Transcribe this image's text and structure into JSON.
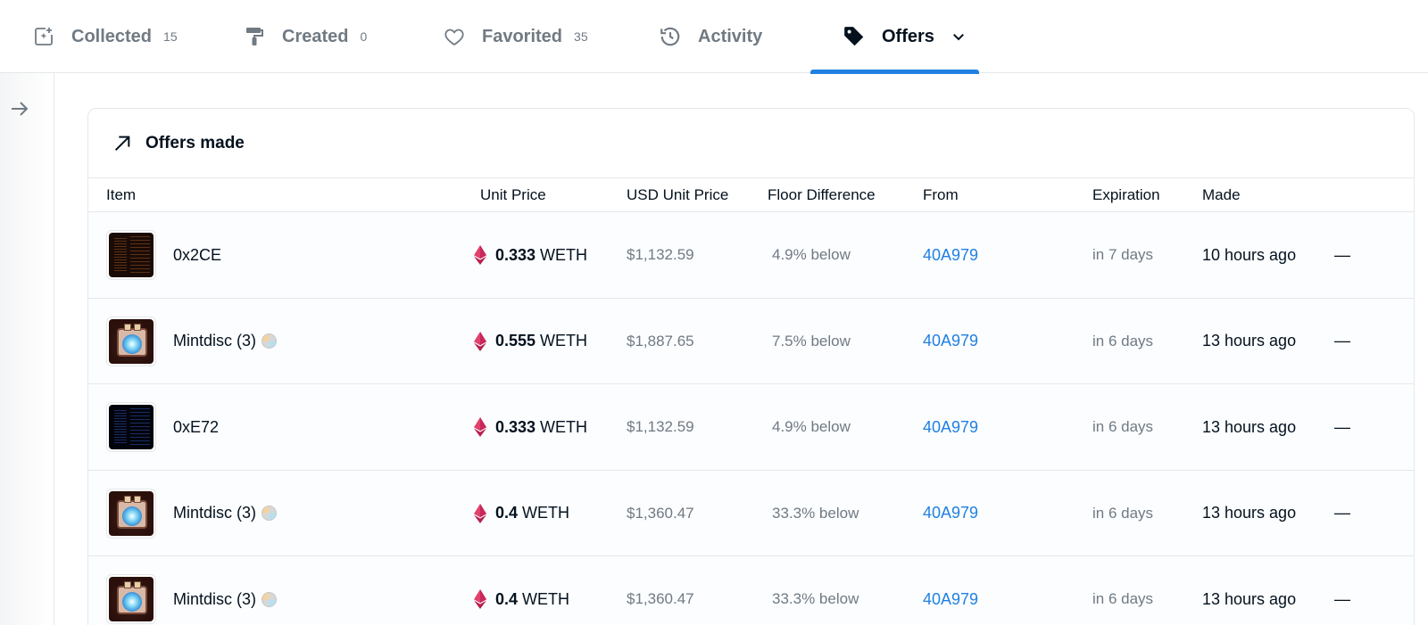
{
  "tabs": [
    {
      "label": "Collected",
      "count": "15",
      "icon": "collected-icon"
    },
    {
      "label": "Created",
      "count": "0",
      "icon": "paint-roller-icon"
    },
    {
      "label": "Favorited",
      "count": "35",
      "icon": "heart-icon"
    },
    {
      "label": "Activity",
      "count": "",
      "icon": "history-icon"
    },
    {
      "label": "Offers",
      "count": "",
      "icon": "tag-icon",
      "active": true
    }
  ],
  "colors": {
    "accent": "#2081e2",
    "text": "#04111d",
    "muted": "#707a83",
    "eth": "#e0426b"
  },
  "card": {
    "title": "Offers made",
    "icon": "arrow-up-right-icon"
  },
  "columns": [
    "Item",
    "Unit Price",
    "USD Unit Price",
    "Floor Difference",
    "From",
    "Expiration",
    "Made"
  ],
  "rows": [
    {
      "item": "0x2CE",
      "thumb": "dark-orange",
      "badge": false,
      "price": "0.333",
      "unit": "WETH",
      "usd": "$1,132.59",
      "floor": "4.9% below",
      "from": "40A979",
      "expiration": "in 7 days",
      "made": "10 hours ago",
      "action": "—"
    },
    {
      "item": "Mintdisc (3)",
      "thumb": "disc",
      "badge": true,
      "price": "0.555",
      "unit": "WETH",
      "usd": "$1,887.65",
      "floor": "7.5% below",
      "from": "40A979",
      "expiration": "in 6 days",
      "made": "13 hours ago",
      "action": "—"
    },
    {
      "item": "0xE72",
      "thumb": "dark-blue",
      "badge": false,
      "price": "0.333",
      "unit": "WETH",
      "usd": "$1,132.59",
      "floor": "4.9% below",
      "from": "40A979",
      "expiration": "in 6 days",
      "made": "13 hours ago",
      "action": "—"
    },
    {
      "item": "Mintdisc (3)",
      "thumb": "disc",
      "badge": true,
      "price": "0.4",
      "unit": "WETH",
      "usd": "$1,360.47",
      "floor": "33.3% below",
      "from": "40A979",
      "expiration": "in 6 days",
      "made": "13 hours ago",
      "action": "—"
    },
    {
      "item": "Mintdisc (3)",
      "thumb": "disc",
      "badge": true,
      "price": "0.4",
      "unit": "WETH",
      "usd": "$1,360.47",
      "floor": "33.3% below",
      "from": "40A979",
      "expiration": "in 6 days",
      "made": "13 hours ago",
      "action": "—"
    }
  ]
}
